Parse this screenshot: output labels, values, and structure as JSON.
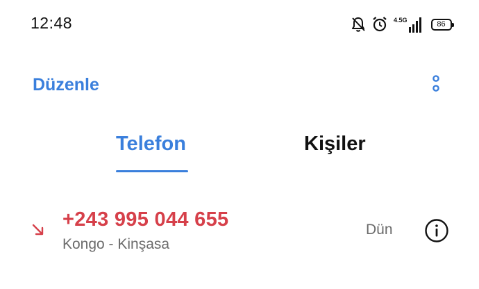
{
  "status_bar": {
    "time": "12:48",
    "network": "4.5G",
    "battery": "86",
    "icons": [
      "bell-off-icon",
      "alarm-icon",
      "signal-icon",
      "battery-icon"
    ]
  },
  "header": {
    "edit_label": "Düzenle",
    "more_icon": "more-vertical-icon"
  },
  "tabs": [
    {
      "label": "Telefon",
      "active": true
    },
    {
      "label": "Kişiler",
      "active": false
    }
  ],
  "calls": [
    {
      "number": "+243 995 044 655",
      "location": "Kongo - Kinşasa",
      "time": "Dün",
      "type": "missed",
      "type_icon": "missed-call-arrow-icon",
      "info_icon": "info-icon"
    }
  ],
  "colors": {
    "accent": "#3a7fdc",
    "missed": "#d6404a",
    "secondary_text": "#6b6b6b"
  }
}
